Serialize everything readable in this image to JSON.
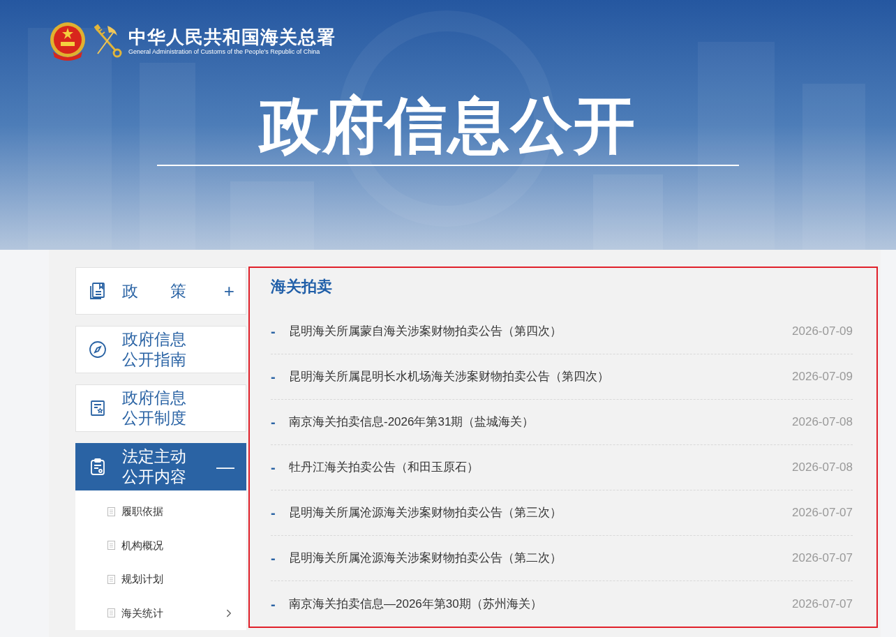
{
  "header": {
    "org_name": "中华人民共和国海关总署",
    "org_name_en": "General Administration of Customs of the People's Republic of China",
    "title": "政府信息公开"
  },
  "sidebar": {
    "sections": [
      {
        "lines": [
          "政策"
        ],
        "kind": "policy",
        "toggle": "+",
        "selected": false
      },
      {
        "lines": [
          "政府信息",
          "公开指南"
        ],
        "kind": "guide",
        "selected": false
      },
      {
        "lines": [
          "政府信息",
          "公开制度"
        ],
        "kind": "system",
        "selected": false
      },
      {
        "lines": [
          "法定主动",
          "公开内容"
        ],
        "kind": "content",
        "toggle": "—",
        "selected": true
      }
    ],
    "sub_items": [
      {
        "label": "履职依据",
        "has_children": false
      },
      {
        "label": "机构概况",
        "has_children": false
      },
      {
        "label": "规划计划",
        "has_children": false
      },
      {
        "label": "海关统计",
        "has_children": true
      }
    ]
  },
  "content": {
    "title": "海关拍卖",
    "highlighted": true,
    "rows": [
      {
        "bullet": "-",
        "title": "昆明海关所属蒙自海关涉案财物拍卖公告（第四次）",
        "date": "2026-07-09"
      },
      {
        "bullet": "-",
        "title": "昆明海关所属昆明长水机场海关涉案财物拍卖公告（第四次）",
        "date": "2026-07-09"
      },
      {
        "bullet": "-",
        "title": "南京海关拍卖信息-2026年第31期（盐城海关）",
        "date": "2026-07-08"
      },
      {
        "bullet": "-",
        "title": "牡丹江海关拍卖公告（和田玉原石）",
        "date": "2026-07-08"
      },
      {
        "bullet": "-",
        "title": "昆明海关所属沧源海关涉案财物拍卖公告（第三次）",
        "date": "2026-07-07"
      },
      {
        "bullet": "-",
        "title": "昆明海关所属沧源海关涉案财物拍卖公告（第二次）",
        "date": "2026-07-07"
      },
      {
        "bullet": "-",
        "title": "南京海关拍卖信息—2026年第30期（苏州海关）",
        "date": "2026-07-07"
      }
    ]
  }
}
